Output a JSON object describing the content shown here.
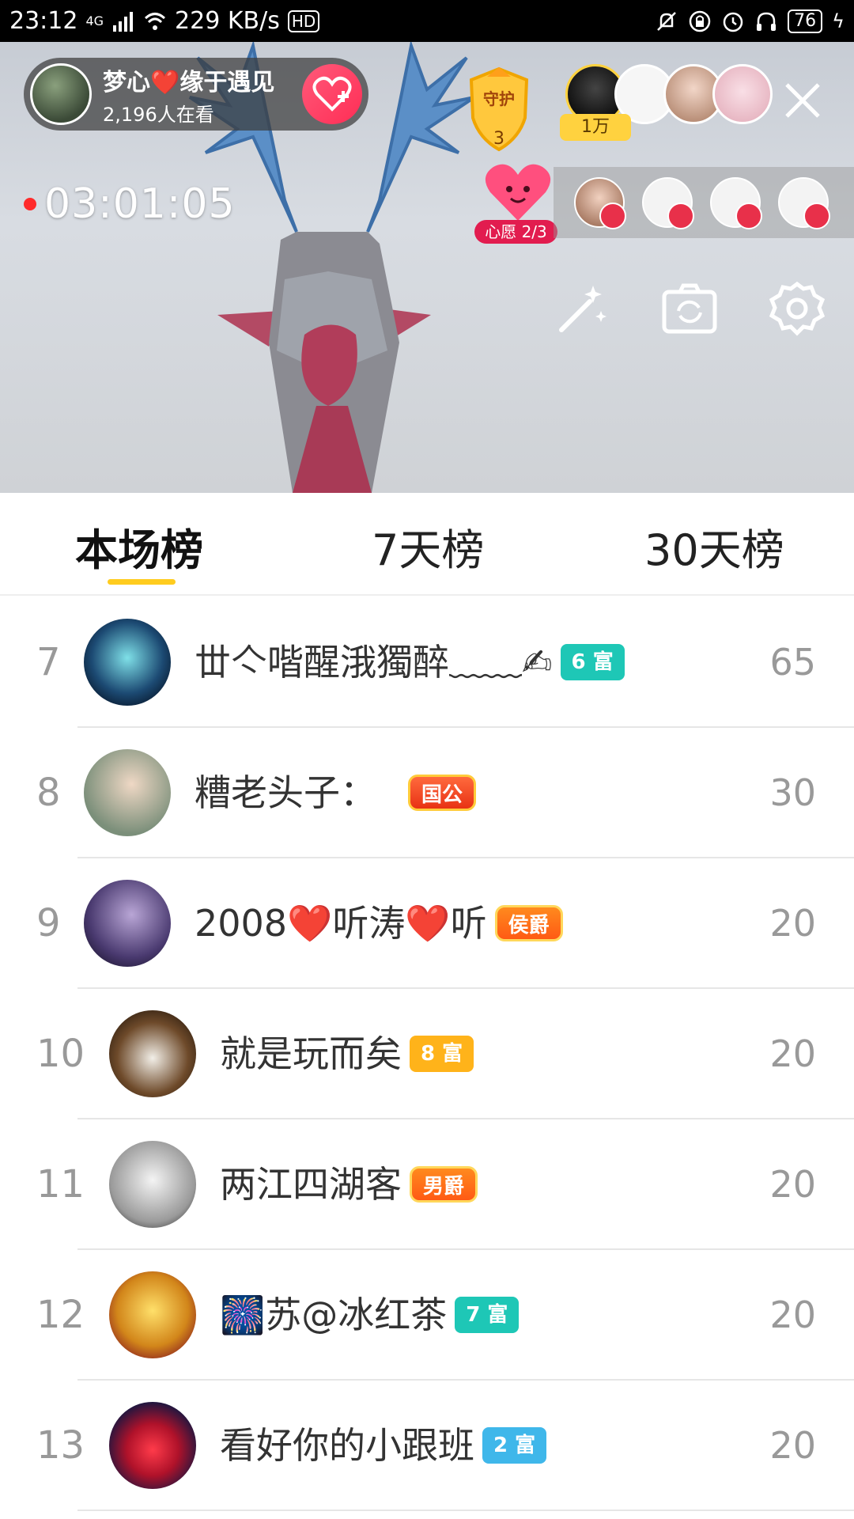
{
  "status_bar": {
    "time": "23:12",
    "network": "4G",
    "speed": "229 KB/s",
    "hd": "HD",
    "battery": "76"
  },
  "live": {
    "host_name": "梦心❤️缘于遇见",
    "viewers": "2,196人在看",
    "guard_label": "守护",
    "guard_count": "3",
    "top_fan_tag": "1万",
    "timer": "03:01:05",
    "wish_label": "心愿 2/3",
    "icons": [
      "follow-heart-icon",
      "close-icon",
      "magic-wand-icon",
      "camera-flip-icon",
      "settings-gear-icon"
    ]
  },
  "tabs": [
    {
      "label": "本场榜",
      "active": true
    },
    {
      "label": "7天榜",
      "active": false
    },
    {
      "label": "30天榜",
      "active": false
    }
  ],
  "ranking": [
    {
      "rank": "7",
      "name": "丗亽喈醒涐獨醉﹏﹏✍",
      "badge": "6 富",
      "badge_style": "cyan",
      "score": "65"
    },
    {
      "rank": "8",
      "name": "糟老头子：",
      "badge": "国公",
      "badge_style": "title",
      "score": "30"
    },
    {
      "rank": "9",
      "name": "2008❤️听涛❤️听",
      "badge": "侯爵",
      "badge_style": "title2",
      "score": "20"
    },
    {
      "rank": "10",
      "name": "就是玩而矣",
      "badge": "8 富",
      "badge_style": "orange",
      "score": "20"
    },
    {
      "rank": "11",
      "name": "两江四湖客",
      "badge": "男爵",
      "badge_style": "title2",
      "score": "20"
    },
    {
      "rank": "12",
      "name": "🎆苏@冰红茶",
      "badge": "7 富",
      "badge_style": "cyan",
      "score": "20"
    },
    {
      "rank": "13",
      "name": "看好你的小跟班",
      "badge": "2 富",
      "badge_style": "blue",
      "score": "20"
    }
  ]
}
